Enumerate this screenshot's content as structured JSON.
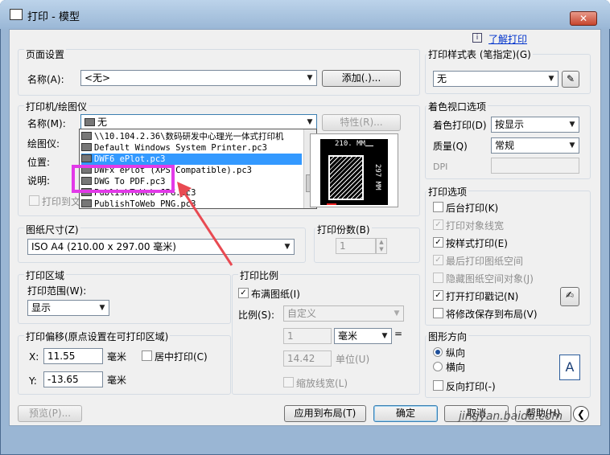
{
  "window": {
    "title": "打印 - 模型",
    "close": "✕"
  },
  "help": {
    "learn": "了解打印",
    "info_icon": "i"
  },
  "page_setup": {
    "group": "页面设置",
    "name_label": "名称(A):",
    "name_value": "<无>",
    "add_button": "添加(.)..."
  },
  "printer": {
    "group": "打印机/绘图仪",
    "name_label": "名称(M):",
    "name_value": "无",
    "properties_button": "特性(R)...",
    "plotter_label": "绘图仪:",
    "location_label": "位置:",
    "desc_label": "说明:",
    "print_to_file": "打印到文",
    "options": [
      "\\\\10.104.2.36\\数码研发中心理光一体式打印机",
      "Default Windows System Printer.pc3",
      "DWF6 ePlot.pc3",
      "DWFx ePlot (XPS Compatible).pc3",
      "DWG To PDF.pc3",
      "PublishToWeb JPG.pc3",
      "PublishToWeb PNG.pc3"
    ],
    "preview_width": "210. MM",
    "preview_height": "297 MM"
  },
  "paper": {
    "group": "图纸尺寸(Z)",
    "value": "ISO A4 (210.00 x 297.00 毫米)"
  },
  "copies": {
    "group": "打印份数(B)",
    "value": "1"
  },
  "area": {
    "group": "打印区域",
    "range_label": "打印范围(W):",
    "range_value": "显示"
  },
  "offset": {
    "group": "打印偏移(原点设置在可打印区域)",
    "x_label": "X:",
    "x_value": "11.55",
    "x_unit": "毫米",
    "y_label": "Y:",
    "y_value": "-13.65",
    "y_unit": "毫米",
    "center": "居中打印(C)"
  },
  "scale": {
    "group": "打印比例",
    "fit": "布满图纸(I)",
    "ratio_label": "比例(S):",
    "ratio_value": "自定义",
    "v1": "1",
    "unit": "毫米",
    "v2": "14.42",
    "unit2": "单位(U)",
    "eq": "=",
    "lineweights": "缩放线宽(L)"
  },
  "style_table": {
    "group": "打印样式表 (笔指定)(G)",
    "value": "无"
  },
  "shaded": {
    "group": "着色视口选项",
    "shade_label": "着色打印(D)",
    "shade_value": "按显示",
    "quality_label": "质量(Q)",
    "quality_value": "常规",
    "dpi_label": "DPI"
  },
  "options": {
    "group": "打印选项",
    "items": [
      "后台打印(K)",
      "打印对象线宽",
      "按样式打印(E)",
      "最后打印图纸空间",
      "隐藏图纸空间对象(J)",
      "打开打印戳记(N)",
      "将修改保存到布局(V)"
    ]
  },
  "orientation": {
    "group": "图形方向",
    "portrait": "纵向",
    "landscape": "横向",
    "reverse": "反向打印(-)",
    "icon_letter": "A"
  },
  "buttons": {
    "preview": "预览(P)...",
    "apply": "应用到布局(T)",
    "ok": "确定",
    "cancel": "取消",
    "help": "帮助(H)"
  },
  "watermark": "jingyan.baidu.com"
}
